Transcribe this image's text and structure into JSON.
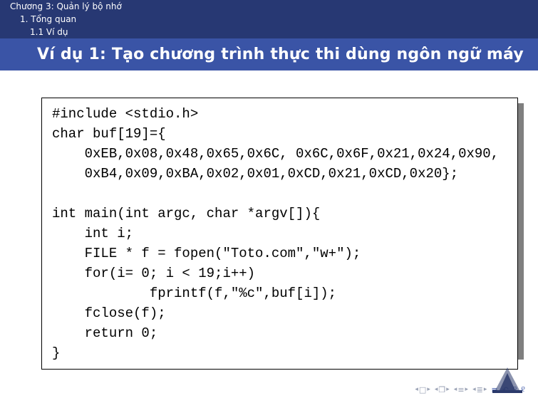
{
  "breadcrumb": {
    "line1": "Chương 3: Quản lý bộ nhớ",
    "line2": "1. Tổng quan",
    "line3": "1.1 Ví dụ"
  },
  "title": "Ví dụ 1: Tạo chương trình thực thi dùng ngôn ngữ máy",
  "code": "#include <stdio.h>\nchar buf[19]={\n    0xEB,0x08,0x48,0x65,0x6C, 0x6C,0x6F,0x21,0x24,0x90,\n    0xB4,0x09,0xBA,0x02,0x01,0xCD,0x21,0xCD,0x20};\n\nint main(int argc, char *argv[]){\n    int i;\n    FILE * f = fopen(\"Toto.com\",\"w+\");\n    for(i= 0; i < 19;i++)\n            fprintf(f,\"%c\",buf[i]);\n    fclose(f);\n    return 0;\n}",
  "nav": {
    "first_left": "◂",
    "first_mid": "□",
    "first_right": "▸",
    "doc_left": "◂",
    "doc_mid": "❐",
    "doc_right": "▸",
    "sec_left": "◂",
    "sec_mid": "≡",
    "sec_right": "▸",
    "sub_left": "◂",
    "sub_mid": "≣",
    "sub_right": "▸",
    "bars": "≡",
    "undo": "↶",
    "redo1": "୨",
    "redo2": "୧"
  }
}
